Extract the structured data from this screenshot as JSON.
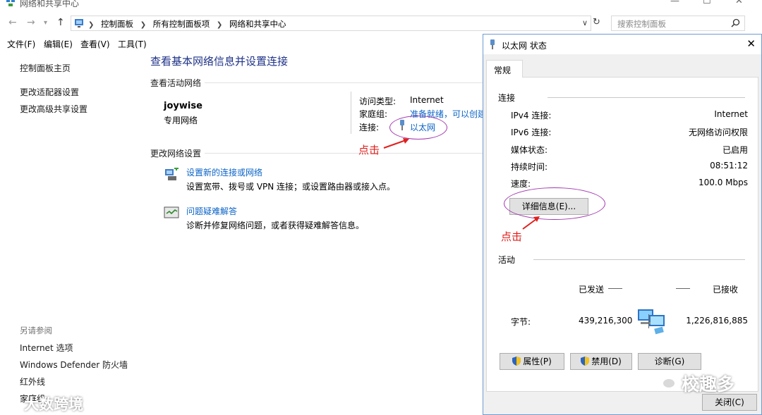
{
  "window": {
    "title": "网络和共享中心",
    "controls": {
      "minimize": "—",
      "maximize": "☐",
      "close": "✕"
    }
  },
  "address": {
    "crumbs": [
      "控制面板",
      "所有控制面板项",
      "网络和共享中心"
    ],
    "search_placeholder": "搜索控制面板"
  },
  "menu": [
    "文件(F)",
    "编辑(E)",
    "查看(V)",
    "工具(T)"
  ],
  "sidebar": {
    "top_links": [
      "控制面板主页",
      "更改适配器设置",
      "更改高级共享设置"
    ],
    "see_also_title": "另请参阅",
    "see_also": [
      "Internet 选项",
      "Windows Defender 防火墙",
      "红外线",
      "家庭组"
    ]
  },
  "main": {
    "title": "查看基本网络信息并设置连接",
    "active_networks_label": "查看活动网络",
    "network_name": "joywise",
    "network_type": "专用网络",
    "access_type_label": "访问类型:",
    "access_type_value": "Internet",
    "homegroup_label": "家庭组:",
    "homegroup_value": "准备就绪，可以创建",
    "connection_label": "连接:",
    "connection_value": "以太网",
    "change_settings_label": "更改网络设置",
    "tasks": [
      {
        "link": "设置新的连接或网络",
        "desc": "设置宽带、拨号或 VPN 连接；或设置路由器或接入点。"
      },
      {
        "link": "问题疑难解答",
        "desc": "诊断并修复网络问题，或者获得疑难解答信息。"
      }
    ]
  },
  "annotations": {
    "click": "点击"
  },
  "dialog": {
    "title": "以太网 状态",
    "tab": "常规",
    "connection_group": "连接",
    "rows": [
      {
        "key": "IPv4 连接:",
        "value": "Internet"
      },
      {
        "key": "IPv6 连接:",
        "value": "无网络访问权限"
      },
      {
        "key": "媒体状态:",
        "value": "已启用"
      },
      {
        "key": "持续时间:",
        "value": "08:51:12"
      },
      {
        "key": "速度:",
        "value": "100.0 Mbps"
      }
    ],
    "details_button": "详细信息(E)...",
    "activity_group": "活动",
    "sent_label": "已发送",
    "received_label": "已接收",
    "bytes_label": "字节:",
    "bytes_sent": "439,216,300",
    "bytes_received": "1,226,816,885",
    "buttons": [
      "属性(P)",
      "禁用(D)",
      "诊断(G)"
    ],
    "close_button": "关闭(C)"
  },
  "watermarks": [
    "校趣多",
    "大数跨境"
  ]
}
